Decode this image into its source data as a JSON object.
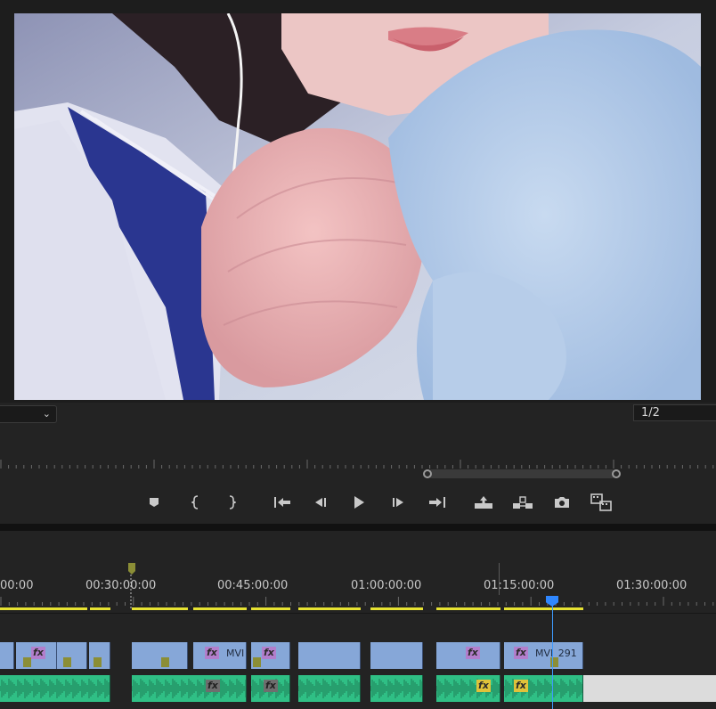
{
  "monitor": {
    "resolution_label": "1/2",
    "zoom_icon": "chevron-down-icon"
  },
  "transport": {
    "buttons": [
      {
        "name": "add-marker-button",
        "icon": "marker-icon"
      },
      {
        "name": "mark-in-button",
        "icon": "mark-in-icon"
      },
      {
        "name": "mark-out-button",
        "icon": "mark-out-icon"
      },
      {
        "name": "go-to-in-button",
        "icon": "go-to-in-icon"
      },
      {
        "name": "step-back-button",
        "icon": "step-back-icon"
      },
      {
        "name": "play-button",
        "icon": "play-icon"
      },
      {
        "name": "step-forward-button",
        "icon": "step-forward-icon"
      },
      {
        "name": "go-to-out-button",
        "icon": "go-to-out-icon"
      },
      {
        "name": "lift-button",
        "icon": "lift-icon"
      },
      {
        "name": "extract-button",
        "icon": "extract-icon"
      },
      {
        "name": "export-frame-button",
        "icon": "camera-icon"
      },
      {
        "name": "comparison-view-button",
        "icon": "compare-icon"
      }
    ]
  },
  "timeline": {
    "timecodes": [
      "00:00",
      "00:30:00:00",
      "00:45:00:00",
      "01:00:00:00",
      "01:15:00:00",
      "01:30:00:00"
    ],
    "clip_labels": {
      "fx": "fx",
      "mvi_short": "MVI",
      "mvi_full": "MVI_291"
    },
    "colors": {
      "video_clip": "#86a7d8",
      "audio_clip": "#2fbf85",
      "playhead": "#2f87ff",
      "work_area": "#e6e232",
      "marker": "#8b8e36"
    }
  }
}
